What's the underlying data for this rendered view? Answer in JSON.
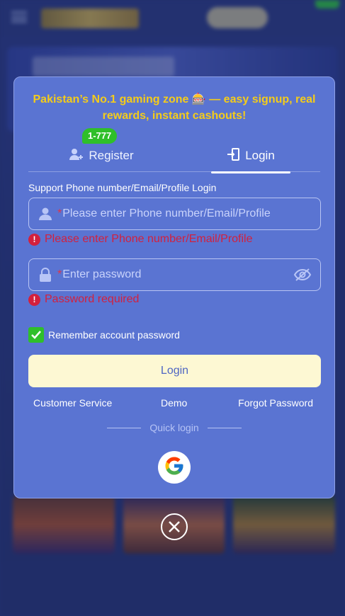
{
  "modal": {
    "tagline": "Pakistan’s No.1 gaming zone 🎰 — easy signup, real rewards, instant cashouts!",
    "tabs": [
      {
        "label": "Register",
        "badge": "1-777",
        "icon": "add-user-icon"
      },
      {
        "label": "Login",
        "icon": "login-door-icon",
        "active": true
      }
    ],
    "account_field": {
      "label": "Support Phone number/Email/Profile Login",
      "required_mark": "*",
      "placeholder": "Please enter Phone number/Email/Profile",
      "value": "",
      "error": "Please enter Phone number/Email/Profile"
    },
    "password_field": {
      "required_mark": "*",
      "placeholder": "Enter password",
      "value": "",
      "error": "Password required",
      "visibility_icon": "eye-off-icon"
    },
    "remember": {
      "label": "Remember account password",
      "checked": true
    },
    "login_button": "Login",
    "links": {
      "customer_service": "Customer Service",
      "demo": "Demo",
      "forgot_password": "Forgot Password"
    },
    "quick_login": "Quick login",
    "social": [
      "google-icon"
    ]
  },
  "colors": {
    "modal_bg": "#5a74d2",
    "tagline": "#f4cc1a",
    "error": "#d3203d",
    "badge": "#2fbf2a",
    "login_button_bg": "#fdf8d3",
    "login_button_text": "#4f66c3"
  }
}
